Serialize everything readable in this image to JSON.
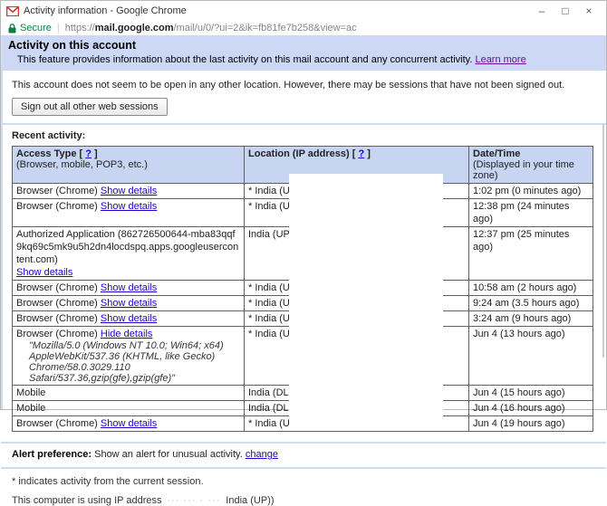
{
  "window": {
    "title": "Activity information - Google Chrome",
    "controls": {
      "minimize": "–",
      "maximize": "□",
      "close": "×"
    }
  },
  "urlbar": {
    "secure_label": "Secure",
    "url_prefix": "https://",
    "url_domain": "mail.google.com",
    "url_path": "/mail/u/0/?ui=2&ik=fb81fe7b258&view=ac"
  },
  "header": {
    "title": "Activity on this account",
    "description": "This feature provides information about the last activity on this mail account and any concurrent activity.",
    "learn_more": "Learn more"
  },
  "session": {
    "message": "This account does not seem to be open in any other location. However, there may be sessions that have not been signed out.",
    "signout_button": "Sign out all other web sessions"
  },
  "recent_activity_label": "Recent activity:",
  "table": {
    "headers": {
      "access_type": "Access Type",
      "bracket_open": "[",
      "help": "?",
      "bracket_close": "]",
      "access_type_sub": "(Browser, mobile, POP3, etc.)",
      "location": "Location (IP address)",
      "datetime": "Date/Time",
      "datetime_sub": "(Displayed in your time zone)"
    },
    "rows": [
      {
        "access": "Browser (Chrome)",
        "details_link": "Show details",
        "location": "* India (U",
        "datetime": "1:02 pm (0 minutes ago)"
      },
      {
        "access": "Browser (Chrome)",
        "details_link": "Show details",
        "location": "* India (U",
        "datetime": "12:38 pm (24 minutes ago)"
      },
      {
        "access": "Authorized Application (862726500644-mba83qqf9kq69c5mk9u5h2dn4locdspq.apps.googleusercontent.com)",
        "details_link": "Show details",
        "location": "India (UP",
        "datetime": "12:37 pm (25 minutes ago)"
      },
      {
        "access": "Browser (Chrome)",
        "details_link": "Show details",
        "location": "* India (U",
        "datetime": "10:58 am (2 hours ago)"
      },
      {
        "access": "Browser (Chrome)",
        "details_link": "Show details",
        "location": "* India (U",
        "datetime": "9:24 am (3.5 hours ago)"
      },
      {
        "access": "Browser (Chrome)",
        "details_link": "Show details",
        "location": "* India (U",
        "datetime": "3:24 am (9 hours ago)"
      },
      {
        "access": "Browser (Chrome)",
        "details_link": "Hide details",
        "ua_lines": [
          "\"Mozilla/5.0 (Windows NT 10.0; Win64; x64)",
          "AppleWebKit/537.36 (KHTML, like Gecko)",
          "Chrome/58.0.3029.110 Safari/537.36,gzip(gfe),gzip(gfe)\""
        ],
        "location": "* India (U",
        "datetime": "Jun 4 (13 hours ago)"
      },
      {
        "access": "Mobile",
        "location": "India (DL",
        "datetime": "Jun 4 (15 hours ago)"
      },
      {
        "access": "Mobile",
        "location": "India (DL",
        "datetime": "Jun 4 (16 hours ago)"
      },
      {
        "access": "Browser (Chrome)",
        "details_link": "Show details",
        "location": "* India (U",
        "datetime": "Jun 4 (19 hours ago)"
      }
    ]
  },
  "footer": {
    "alert_pref_label": "Alert preference:",
    "alert_pref_text": "Show an alert for unusual activity.",
    "change_link": "change",
    "current_session_note": "* indicates activity from the current session.",
    "ip_line_prefix": "This computer is using IP address",
    "ip_redacted": "··· ··· · ···",
    "ip_line_suffix": "India (UP))"
  },
  "colors": {
    "banner_bg": "#ccd8f6",
    "table_header_bg": "#c7d5f2",
    "table_border": "#606060",
    "link_blue": "#2200cc",
    "visited_purple": "#661199",
    "secure_green": "#0b8043",
    "gmail_red": "#d5342c",
    "separator_blue": "#cfdcf3"
  }
}
